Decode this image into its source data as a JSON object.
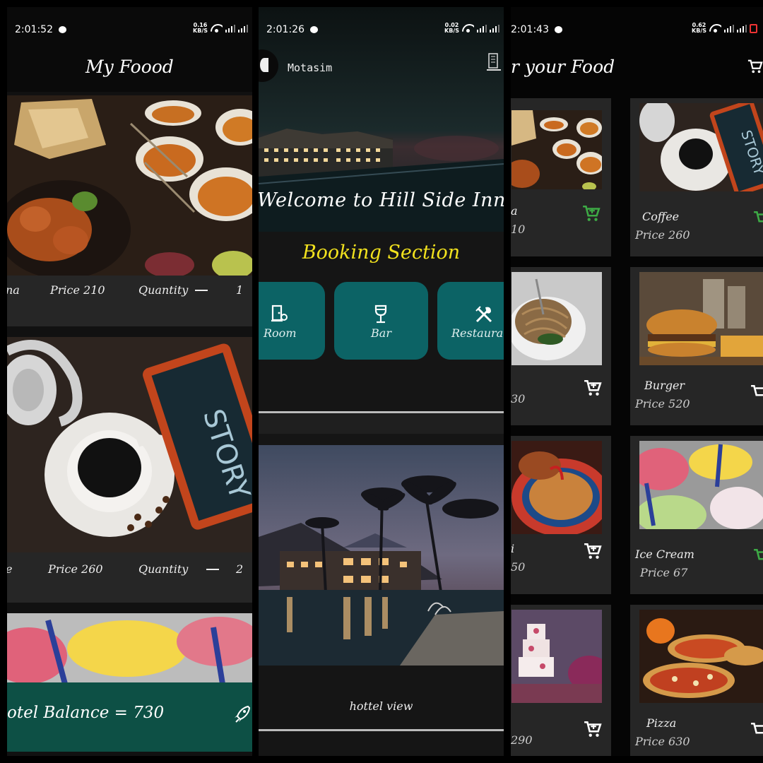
{
  "screen1": {
    "status": {
      "time": "2:01:52",
      "speed_value": "0.16",
      "speed_unit": "KB/S"
    },
    "title": "My Foood",
    "items": [
      {
        "name": "na",
        "price": "Price 210",
        "quantity_label": "Quantity",
        "quantity": "1"
      },
      {
        "name": "e",
        "price": "Price 260",
        "quantity_label": "Quantity",
        "quantity": "2"
      }
    ],
    "balance": "otel Balance = 730"
  },
  "screen2": {
    "status": {
      "time": "2:01:26",
      "speed_value": "0.02",
      "speed_unit": "KB/S"
    },
    "user_name": "Motasim",
    "welcome": "Welcome to Hill Side Inn",
    "section_title": "Booking Section",
    "buttons": [
      {
        "label": "Room",
        "icon": "door-icon"
      },
      {
        "label": "Bar",
        "icon": "wine-glass-icon"
      },
      {
        "label": "Restaura",
        "icon": "restaurant-icon"
      }
    ],
    "view_caption": "hottel view"
  },
  "screen3": {
    "status": {
      "time": "2:01:43",
      "speed_value": "0.62",
      "speed_unit": "KB/S"
    },
    "title": "r your Food",
    "left_items": [
      {
        "name": "a",
        "price": "10",
        "cart_color": "#3daa45"
      },
      {
        "name": "",
        "price": "30",
        "cart_color": "#ffffff"
      },
      {
        "name": "i",
        "price": "50",
        "cart_color": "#ffffff"
      },
      {
        "name": "",
        "price": "290",
        "cart_color": "#ffffff"
      }
    ],
    "right_items": [
      {
        "name": "Coffee",
        "price": "Price 260"
      },
      {
        "name": "Burger",
        "price": "Price 520"
      },
      {
        "name": "Ice Cream",
        "price": "Price 67"
      },
      {
        "name": "Pizza",
        "price": "Price 630"
      }
    ]
  },
  "colors": {
    "teal_button": "#0c6365",
    "balance_bar": "#0d5045",
    "section_yellow": "#f2e21e",
    "cart_green": "#3daa45"
  }
}
